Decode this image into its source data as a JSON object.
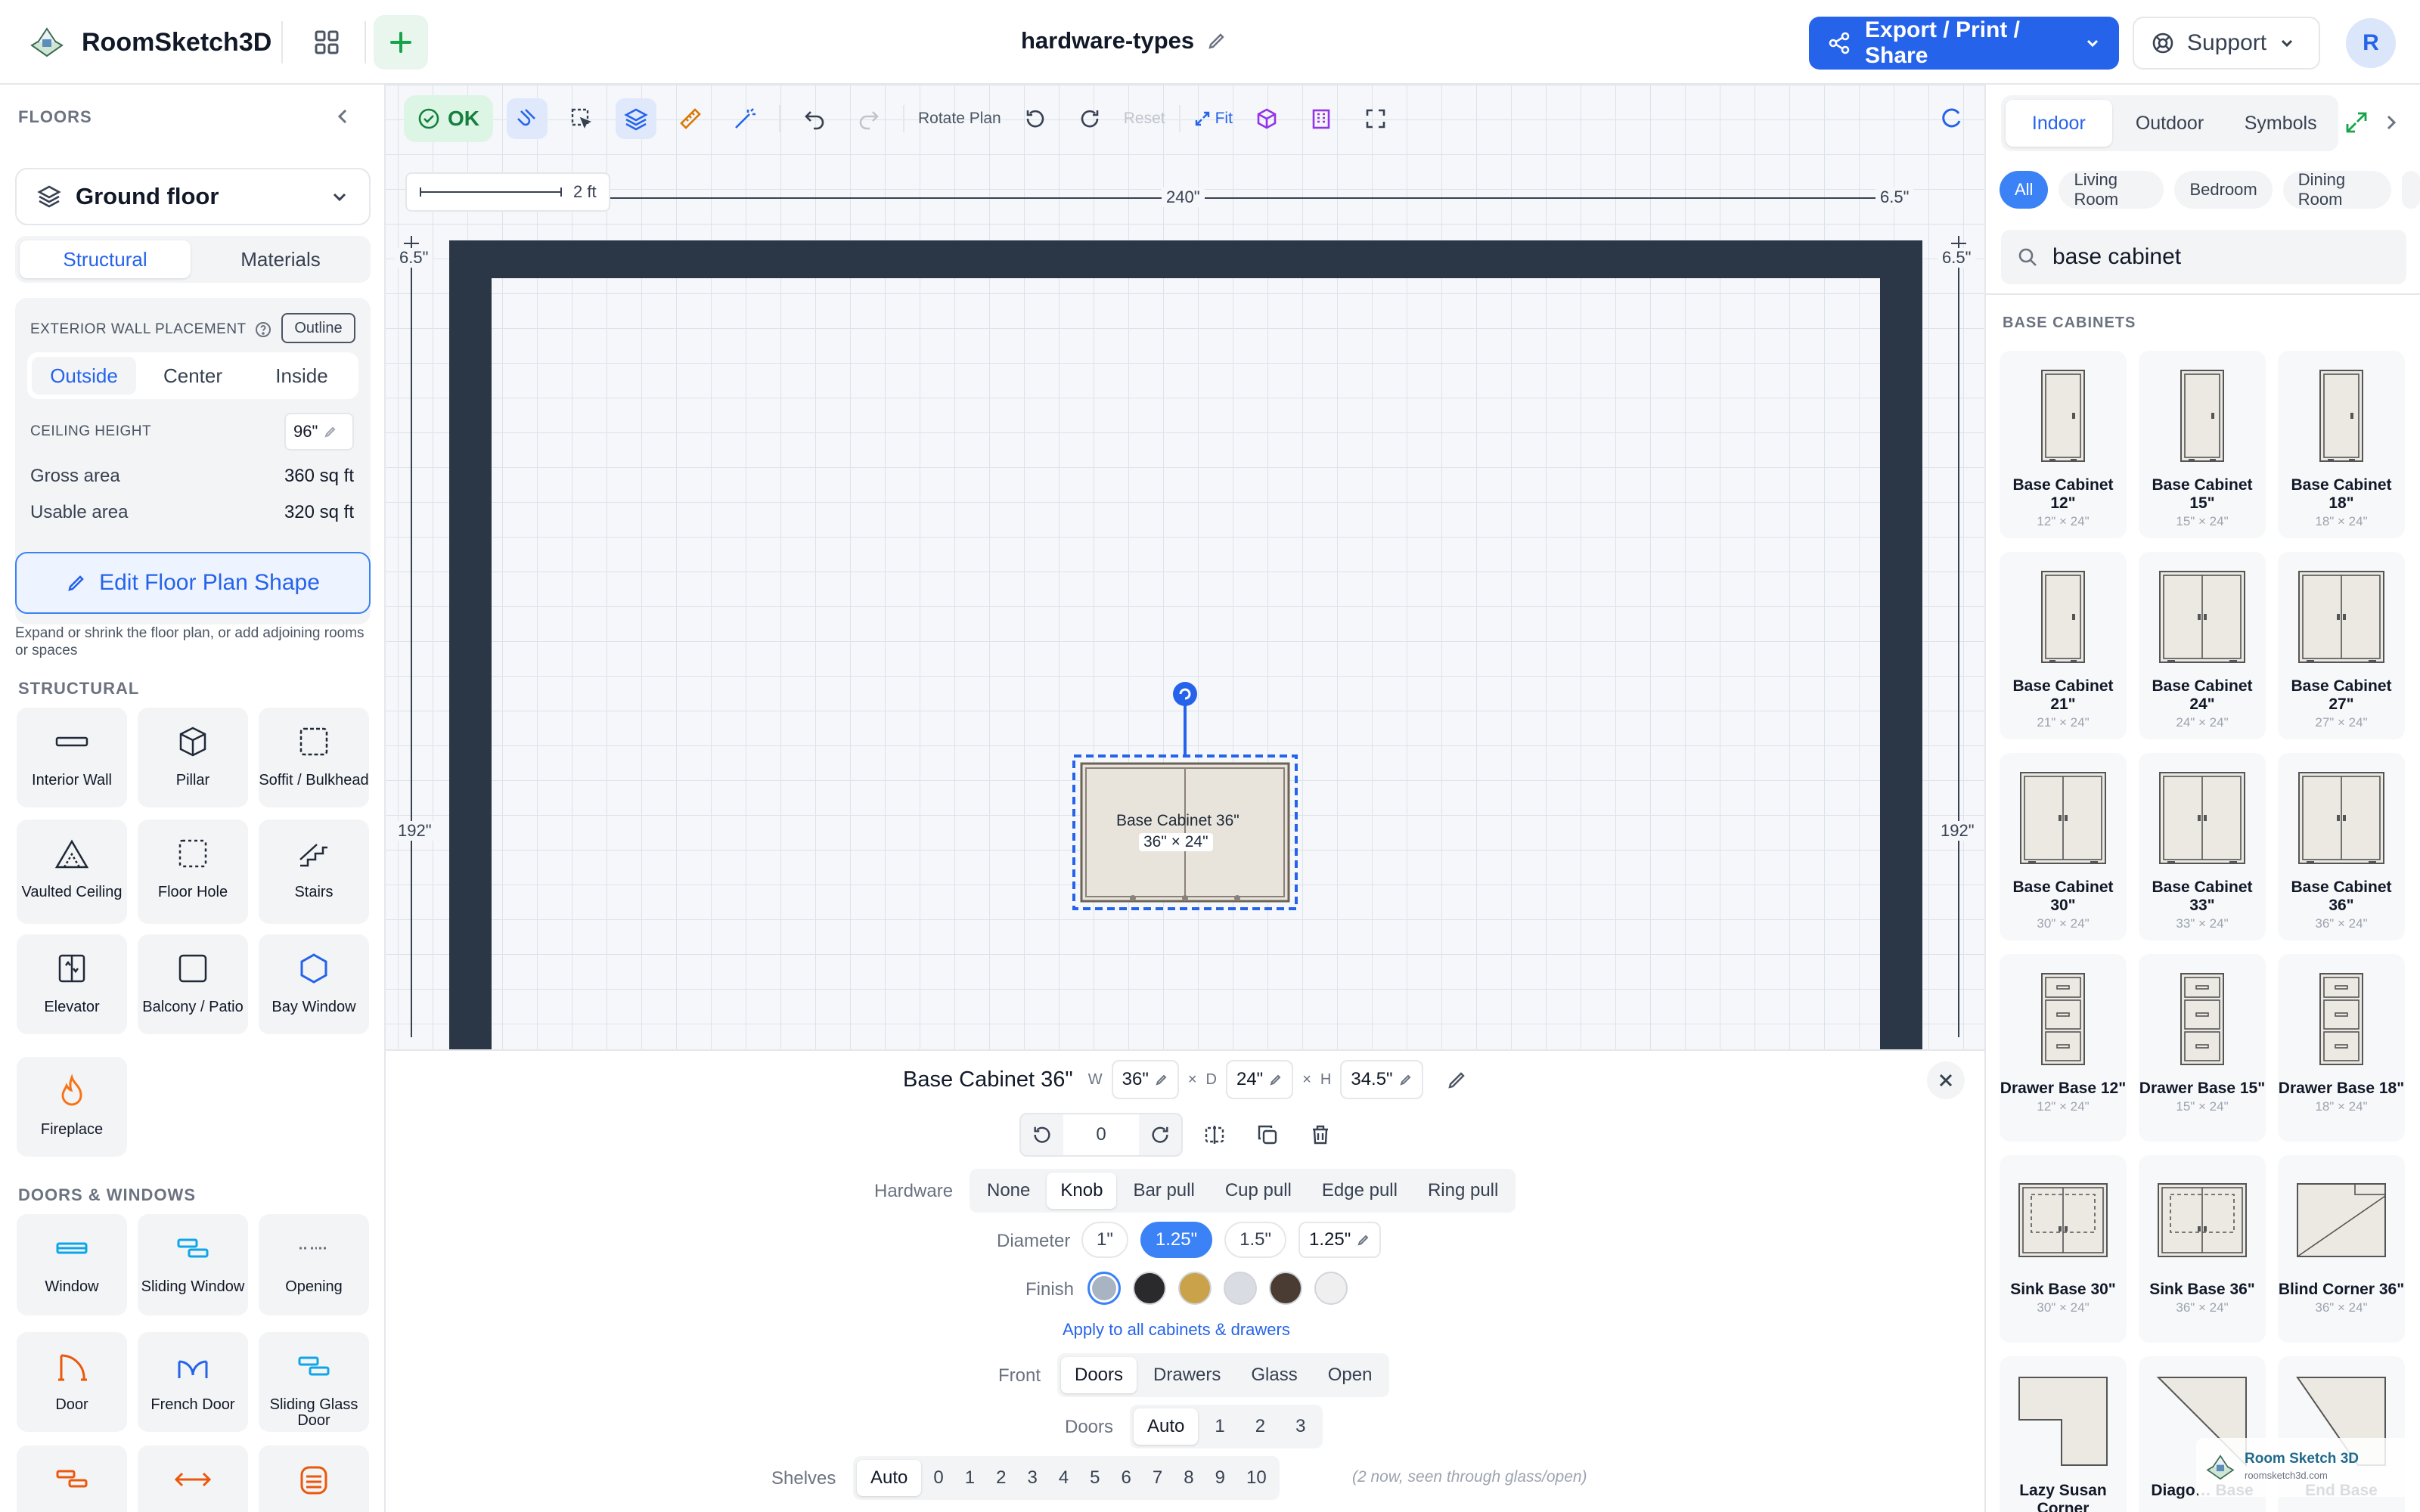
{
  "app": {
    "name": "RoomSketch3D",
    "project": "hardware-types",
    "export_label": "Export / Print / Share",
    "support_label": "Support",
    "avatar": "R"
  },
  "left": {
    "floors_title": "FLOORS",
    "floor": "Ground floor",
    "tabs": [
      "Structural",
      "Materials"
    ],
    "wall_placement_label": "EXTERIOR WALL PLACEMENT",
    "outline_label": "Outline",
    "placement_options": [
      "Outside",
      "Center",
      "Inside"
    ],
    "ceiling_label": "CEILING HEIGHT",
    "ceiling_value": "96\"",
    "gross_label": "Gross area",
    "gross_value": "360 sq ft",
    "usable_label": "Usable area",
    "usable_value": "320 sq ft",
    "edit_btn": "Edit Floor Plan Shape",
    "edit_hint": "Expand or shrink the floor plan, or add adjoining rooms or spaces",
    "structural_title": "STRUCTURAL",
    "structural": [
      "Interior Wall",
      "Pillar",
      "Soffit / Bulkhead",
      "Vaulted Ceiling",
      "Floor Hole",
      "Stairs",
      "Elevator",
      "Balcony / Patio",
      "Bay Window",
      "Fireplace"
    ],
    "doors_title": "DOORS & WINDOWS",
    "doors": [
      "Window",
      "Sliding Window",
      "Opening",
      "Door",
      "French Door",
      "Sliding Glass Door"
    ]
  },
  "toolbar": {
    "ok": "OK",
    "rotate": "Rotate Plan",
    "reset": "Reset",
    "fit": "Fit"
  },
  "canvas": {
    "scale": "2 ft",
    "top_dim": "240\"",
    "side_dim": "192\"",
    "wall_dim": "6.5\"",
    "item_name": "Base Cabinet 36\"",
    "item_size": "36\" × 24\""
  },
  "panel": {
    "title": "Base Cabinet 36\"",
    "w_label": "W",
    "w": "36\"",
    "x": "×",
    "d_label": "D",
    "d": "24\"",
    "h_label": "H",
    "h": "34.5\"",
    "rotation": "0",
    "hardware_label": "Hardware",
    "hardware": [
      "None",
      "Knob",
      "Bar pull",
      "Cup pull",
      "Edge pull",
      "Ring pull"
    ],
    "hardware_selected": "Knob",
    "diameter_label": "Diameter",
    "diameters": [
      "1\"",
      "1.25\"",
      "1.5\""
    ],
    "diameter_selected": "1.25\"",
    "diameter_custom": "1.25\"",
    "finish_label": "Finish",
    "finishes": [
      "#a9b4c2",
      "#2a2a2c",
      "#c9a24a",
      "#d9dce3",
      "#4a3c32",
      "#efefef"
    ],
    "apply_all": "Apply to all cabinets & drawers",
    "front_label": "Front",
    "fronts": [
      "Doors",
      "Drawers",
      "Glass",
      "Open"
    ],
    "front_selected": "Doors",
    "doors_label": "Doors",
    "doors_opts": [
      "Auto",
      "1",
      "2",
      "3"
    ],
    "doors_selected": "Auto",
    "shelves_label": "Shelves",
    "shelves": [
      "Auto",
      "0",
      "1",
      "2",
      "3",
      "4",
      "5",
      "6",
      "7",
      "8",
      "9",
      "10"
    ],
    "shelves_selected": "Auto",
    "shelves_note": "(2 now, seen through glass/open)"
  },
  "right": {
    "tabs": [
      "Indoor",
      "Outdoor",
      "Symbols"
    ],
    "chips": [
      "All",
      "Living Room",
      "Bedroom",
      "Dining Room"
    ],
    "search": "base cabinet",
    "section": "BASE CABINETS",
    "items": [
      {
        "name": "Base Cabinet 12\"",
        "size": "12\" × 24\"",
        "kind": "door1"
      },
      {
        "name": "Base Cabinet 15\"",
        "size": "15\" × 24\"",
        "kind": "door1"
      },
      {
        "name": "Base Cabinet 18\"",
        "size": "18\" × 24\"",
        "kind": "door1"
      },
      {
        "name": "Base Cabinet 21\"",
        "size": "21\" × 24\"",
        "kind": "door1"
      },
      {
        "name": "Base Cabinet 24\"",
        "size": "24\" × 24\"",
        "kind": "door2"
      },
      {
        "name": "Base Cabinet 27\"",
        "size": "27\" × 24\"",
        "kind": "door2"
      },
      {
        "name": "Base Cabinet 30\"",
        "size": "30\" × 24\"",
        "kind": "door2"
      },
      {
        "name": "Base Cabinet 33\"",
        "size": "33\" × 24\"",
        "kind": "door2"
      },
      {
        "name": "Base Cabinet 36\"",
        "size": "36\" × 24\"",
        "kind": "door2"
      },
      {
        "name": "Drawer Base 12\"",
        "size": "12\" × 24\"",
        "kind": "drawer"
      },
      {
        "name": "Drawer Base 15\"",
        "size": "15\" × 24\"",
        "kind": "drawer"
      },
      {
        "name": "Drawer Base 18\"",
        "size": "18\" × 24\"",
        "kind": "drawer"
      },
      {
        "name": "Sink Base 30\"",
        "size": "30\" × 24\"",
        "kind": "sink"
      },
      {
        "name": "Sink Base 36\"",
        "size": "36\" × 24\"",
        "kind": "sink"
      },
      {
        "name": "Blind Corner 36\"",
        "size": "36\" × 24\"",
        "kind": "blind"
      },
      {
        "name": "Lazy Susan Corner",
        "size": "",
        "kind": "lazy"
      },
      {
        "name": "Diago… Base",
        "size": "",
        "kind": "diag"
      },
      {
        "name": "End Base",
        "size": "",
        "kind": "end"
      }
    ],
    "watermark": "Room Sketch 3D",
    "watermark_url": "roomsketch3d.com"
  }
}
